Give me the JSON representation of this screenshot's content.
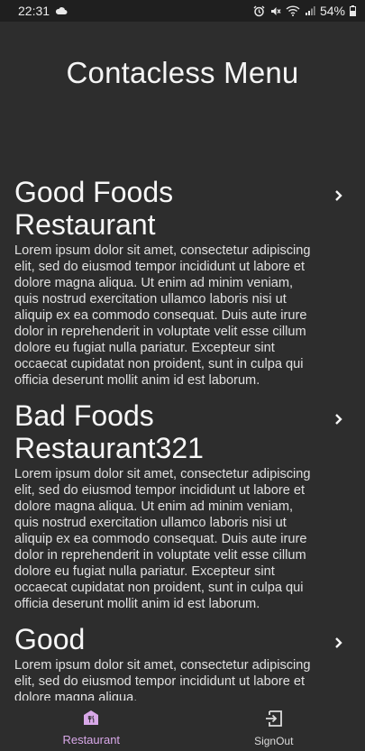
{
  "status_bar": {
    "time": "22:31",
    "battery_percent": "54%",
    "icons": [
      "cloud-icon",
      "alarm-icon",
      "mute-icon",
      "wifi-icon",
      "signal-icon",
      "battery-icon"
    ]
  },
  "header": {
    "title": "Contacless Menu"
  },
  "restaurants": [
    {
      "name": "Good Foods Restaurant",
      "description": "Lorem ipsum dolor sit amet, consectetur adipiscing elit, sed do eiusmod tempor incididunt ut labore et dolore magna aliqua. Ut enim ad minim veniam, quis nostrud exercitation ullamco laboris nisi ut aliquip ex ea commodo consequat. Duis aute irure dolor in reprehenderit in voluptate velit esse cillum dolore eu fugiat nulla pariatur. Excepteur sint occaecat cupidatat non proident, sunt in culpa qui officia deserunt mollit anim id est laborum."
    },
    {
      "name": "Bad Foods Restaurant321",
      "description": "Lorem ipsum dolor sit amet, consectetur adipiscing elit, sed do eiusmod tempor incididunt ut labore et dolore magna aliqua. Ut enim ad minim veniam, quis nostrud exercitation ullamco laboris nisi ut aliquip ex ea commodo consequat. Duis aute irure dolor in reprehenderit in voluptate velit esse cillum dolore eu fugiat nulla pariatur. Excepteur sint occaecat cupidatat non proident, sunt in culpa qui officia deserunt mollit anim id est laborum."
    },
    {
      "name": "Good",
      "description": "Lorem ipsum dolor sit amet, consectetur adipiscing elit, sed do eiusmod tempor incididunt ut labore et dolore magna aliqua."
    }
  ],
  "bottom_nav": {
    "items": [
      {
        "label": "Restaurant",
        "icon": "restaurant-icon",
        "active": true
      },
      {
        "label": "SignOut",
        "icon": "signout-icon",
        "active": false
      }
    ]
  },
  "colors": {
    "background": "#2d2d2d",
    "status_bar": "#1f1f1f",
    "active_nav": "#d8a8e8",
    "text": "#f2f2f2"
  }
}
